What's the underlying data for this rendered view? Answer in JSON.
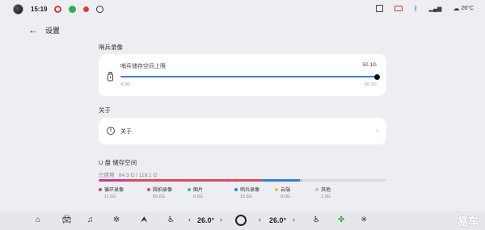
{
  "status_bar": {
    "time": "15:19",
    "temperature": "26°C",
    "icons": [
      "avatar",
      "app-red-icon",
      "app-green-icon",
      "app-red-dot-icon",
      "camera-icon",
      "bluetooth-icon",
      "signal-icon",
      "weather-icon"
    ]
  },
  "header": {
    "back_symbol": "←",
    "title": "设置"
  },
  "sentry": {
    "section_label": "哨兵录像",
    "limit_title": "哨兵储存空间上限",
    "limit_value": "50.1G",
    "slider_min": "4.0G",
    "slider_max": "50.1G",
    "slider_fraction": 1.0,
    "accent_color": "#3d7fd8"
  },
  "about": {
    "section_label": "关于",
    "item_label": "关于",
    "chevron": "›"
  },
  "storage": {
    "section_label": "U 盘 储存空间",
    "used_label": "已使用",
    "used_value": "84.3 G / 119.1 G",
    "segments": [
      {
        "name": "循环录像",
        "size": "11.0G",
        "color": "#c93a8c",
        "fraction": 0.092
      },
      {
        "name": "踩拍录像",
        "size": "56.6G",
        "color": "#e0485a",
        "fraction": 0.475
      },
      {
        "name": "图片",
        "size": "0.0G",
        "color": "#3fbf6a",
        "fraction": 0.0
      },
      {
        "name": "哨兵录像",
        "size": "15.8G",
        "color": "#2f7fe0",
        "fraction": 0.133
      },
      {
        "name": "云端",
        "size": "0.0G",
        "color": "#f0c234",
        "fraction": 0.0
      },
      {
        "name": "其他",
        "size": "1.0G",
        "color": "#c7b8d8",
        "fraction": 0.008
      }
    ]
  },
  "dock": {
    "left_temp": "26.0°",
    "right_temp": "26.0°",
    "left_arrow": "‹",
    "right_arrow": "›",
    "watermark": "易车"
  }
}
